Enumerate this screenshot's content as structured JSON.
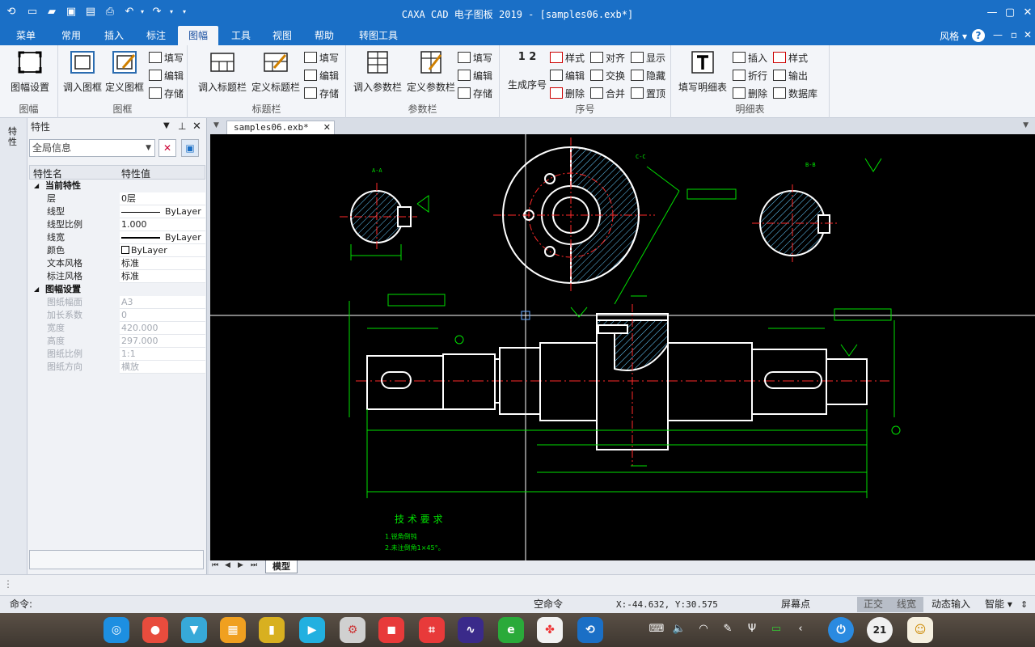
{
  "window": {
    "title": "CAXA CAD 电子图板 2019 - [samples06.exb*]",
    "minimize": "—",
    "maximize": "▢",
    "close": "✕"
  },
  "menu_tabs": [
    "菜单",
    "常用",
    "插入",
    "标注",
    "图幅",
    "工具",
    "视图",
    "帮助",
    "转图工具"
  ],
  "active_tab": "图幅",
  "style_label": "风格",
  "ribbon": {
    "groups": {
      "frame_setup": {
        "label": "图幅",
        "btn": "图幅设置"
      },
      "frame": {
        "label": "图框",
        "load": "调入图框",
        "define": "定义图框",
        "fill": "填写",
        "edit": "编辑",
        "save": "存储"
      },
      "titleblock": {
        "label": "标题栏",
        "load": "调入标题栏",
        "define": "定义标题栏",
        "fill": "填写",
        "edit": "编辑",
        "save": "存储"
      },
      "parambar": {
        "label": "参数栏",
        "load": "调入参数栏",
        "define": "定义参数栏",
        "fill": "填写",
        "edit": "编辑",
        "save": "存储"
      },
      "serial": {
        "label": "序号",
        "generate": "生成序号",
        "gen_icon_text": "1 2",
        "style": "样式",
        "edit": "编辑",
        "delete": "删除",
        "align": "对齐",
        "swap": "交换",
        "merge": "合并",
        "show": "显示",
        "hide": "隐藏",
        "top": "置顶"
      },
      "bom": {
        "label": "明细表",
        "fill": "填写明细表",
        "insert": "插入",
        "fold": "折行",
        "delete": "删除",
        "style": "样式",
        "export": "输出",
        "database": "数据库"
      }
    }
  },
  "side_strip": {
    "label": "特性"
  },
  "properties": {
    "title": "特性",
    "combo_value": "全局信息",
    "col_name": "特性名",
    "col_value": "特性值",
    "rows": [
      {
        "key": "当前特性",
        "cat": true
      },
      {
        "key": "层",
        "val": "0层"
      },
      {
        "key": "线型",
        "val": "ByLayer"
      },
      {
        "key": "线型比例",
        "val": "1.000"
      },
      {
        "key": "线宽",
        "val": "ByLayer"
      },
      {
        "key": "颜色",
        "val": "ByLayer"
      },
      {
        "key": "文本风格",
        "val": "标准"
      },
      {
        "key": "标注风格",
        "val": "标准"
      },
      {
        "key": "图幅设置",
        "cat": true
      },
      {
        "key": "图纸幅面",
        "val": "A3",
        "dis": true
      },
      {
        "key": "加长系数",
        "val": "0",
        "dis": true
      },
      {
        "key": "宽度",
        "val": "420.000",
        "dis": true
      },
      {
        "key": "高度",
        "val": "297.000",
        "dis": true
      },
      {
        "key": "图纸比例",
        "val": "1:1",
        "dis": true
      },
      {
        "key": "图纸方向",
        "val": "横放",
        "dis": true
      }
    ]
  },
  "document_tab": "samples06.exb*",
  "drawing": {
    "view_labels": [
      "A-A",
      "C-C",
      "B-B"
    ],
    "tech_req_title": "技 术 要 求",
    "tech_req_lines": [
      "1.锐角倒钝",
      "2.未注倒角1×45°。"
    ]
  },
  "sheet_tab": "模型",
  "command_prompt": "命令:",
  "status": {
    "mode": "空命令",
    "coords": "X:-44.632, Y:30.575",
    "snap": "屏幕点",
    "ortho": "正交",
    "linewidth": "线宽",
    "dynamic_input": "动态输入",
    "smart": "智能"
  },
  "taskbar": {
    "clock": "21"
  },
  "colors": {
    "title_bar": "#1a6fc6",
    "canvas_bg": "#000000",
    "dim_green": "#00e000",
    "outline_white": "#ffffff",
    "center_red": "#ff2a2a",
    "hatch_cyan": "#66ccff"
  }
}
